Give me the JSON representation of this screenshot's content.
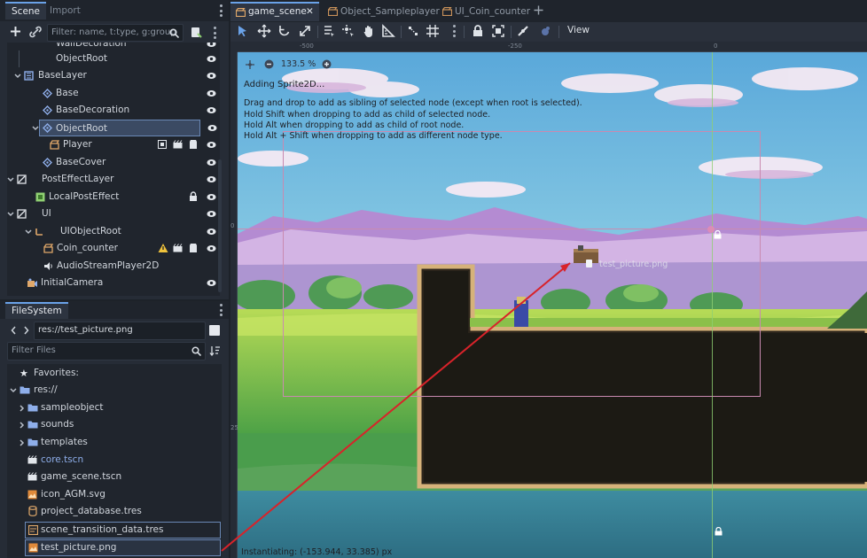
{
  "scene_dock": {
    "tabs": [
      "Scene",
      "Import"
    ],
    "filter_placeholder": "Filter: name, t:type, g:group",
    "tree": [
      {
        "label": "WallDecoration",
        "icon": "node2d-icon"
      },
      {
        "label": "ObjectRoot",
        "icon": "none"
      },
      {
        "label": "BaseLayer",
        "icon": "canvas-layer-icon"
      },
      {
        "label": "Base",
        "icon": "tilemap-layer-icon"
      },
      {
        "label": "BaseDecoration",
        "icon": "tilemap-layer-icon"
      },
      {
        "label": "ObjectRoot",
        "icon": "tilemap-layer-icon"
      },
      {
        "label": "Player",
        "icon": "packed-scene-icon"
      },
      {
        "label": "BaseCover",
        "icon": "tilemap-layer-icon"
      },
      {
        "label": "PostEffectLayer",
        "icon": "canvas-layer-icon"
      },
      {
        "label": "LocalPostEffect",
        "icon": "color-rect-icon"
      },
      {
        "label": "UI",
        "icon": "canvas-layer-icon"
      },
      {
        "label": "UIObjectRoot",
        "icon": "node2d-icon"
      },
      {
        "label": "Coin_counter",
        "icon": "packed-scene-icon"
      },
      {
        "label": "AudioStreamPlayer2D",
        "icon": "audio-icon"
      },
      {
        "label": "InitialCamera",
        "icon": "camera-icon"
      }
    ]
  },
  "filesystem": {
    "title": "FileSystem",
    "path": "res://test_picture.png",
    "filter_placeholder": "Filter Files",
    "items": [
      {
        "label": "Favorites:",
        "icon": "star-icon"
      },
      {
        "label": "res://",
        "icon": "folder-icon"
      },
      {
        "label": "sampleobject",
        "icon": "folder-icon"
      },
      {
        "label": "sounds",
        "icon": "folder-icon"
      },
      {
        "label": "templates",
        "icon": "folder-icon"
      },
      {
        "label": "core.tscn",
        "icon": "scene-file-icon"
      },
      {
        "label": "game_scene.tscn",
        "icon": "scene-file-icon"
      },
      {
        "label": "icon_AGM.svg",
        "icon": "image-file-icon"
      },
      {
        "label": "project_database.tres",
        "icon": "resource-file-icon"
      },
      {
        "label": "scene_transition_data.tres",
        "icon": "resource-file-icon"
      },
      {
        "label": "test_picture.png",
        "icon": "image-file-icon"
      }
    ]
  },
  "editor": {
    "tabs": [
      "game_scene",
      "Object_Sampleplayer",
      "UI_Coin_counter"
    ],
    "view_label": "View",
    "zoom_label": "133.5 %",
    "ruler_labels": [
      "-500",
      "-250",
      "0",
      "0",
      "250"
    ],
    "overlay": {
      "title": "Adding Sprite2D...",
      "lines": [
        "Drag and drop to add as sibling of selected node (except when root is selected).",
        "Hold Shift when dropping to add as child of selected node.",
        "Hold Alt when dropping to add as child of root node.",
        "Hold Alt + Shift when dropping to add as different node type."
      ]
    },
    "drag_preview_label": "test_picture.png",
    "status_text": "Instantiating: (-153.944, 33.385) px"
  },
  "colors": {
    "accent": "#6aa2e8",
    "drag_arrow": "#d8232a",
    "rect_outline": "#c98ab0"
  }
}
